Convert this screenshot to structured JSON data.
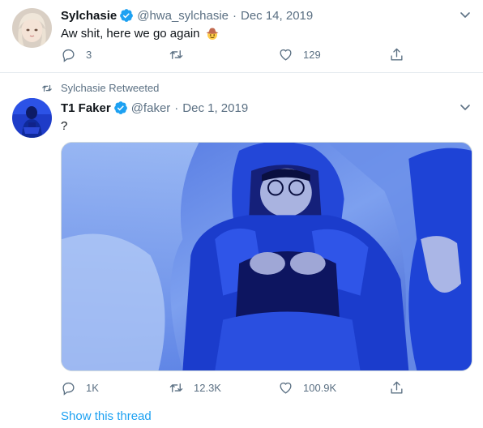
{
  "tweet1": {
    "name": "Sylchasie",
    "handle": "@hwa_sylchasie",
    "separator": "·",
    "date": "Dec 14, 2019",
    "text": "Aw shit, here we go again",
    "emoji": "cowboy-hat-face",
    "replies": "3",
    "retweets": "",
    "likes": "129"
  },
  "tweet2": {
    "retweeted_by": "Sylchasie Retweeted",
    "name": "T1 Faker",
    "handle": "@faker",
    "separator": "·",
    "date": "Dec 1, 2019",
    "text": "?",
    "replies": "1K",
    "retweets": "12.3K",
    "likes": "100.9K",
    "show_thread": "Show this thread"
  },
  "colors": {
    "accent": "#1da1f2",
    "muted": "#5b7083",
    "divider": "#e6ecf0"
  }
}
